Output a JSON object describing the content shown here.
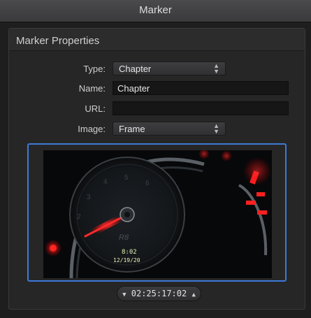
{
  "window": {
    "title": "Marker"
  },
  "panel": {
    "title": "Marker Properties",
    "type": {
      "label": "Type:",
      "value": "Chapter"
    },
    "name": {
      "label": "Name:",
      "value": "Chapter"
    },
    "url": {
      "label": "URL:",
      "value": ""
    },
    "image": {
      "label": "Image:",
      "value": "Frame"
    }
  },
  "preview": {
    "odometer_time": "8:02",
    "odometer_date": "12/19/20"
  },
  "timecode": {
    "value": "02:25:17:02",
    "down_icon": "triangle-down-icon",
    "up_icon": "triangle-up-icon"
  },
  "colors": {
    "selection": "#3d7ad6",
    "needle": "#ff2a2a"
  }
}
